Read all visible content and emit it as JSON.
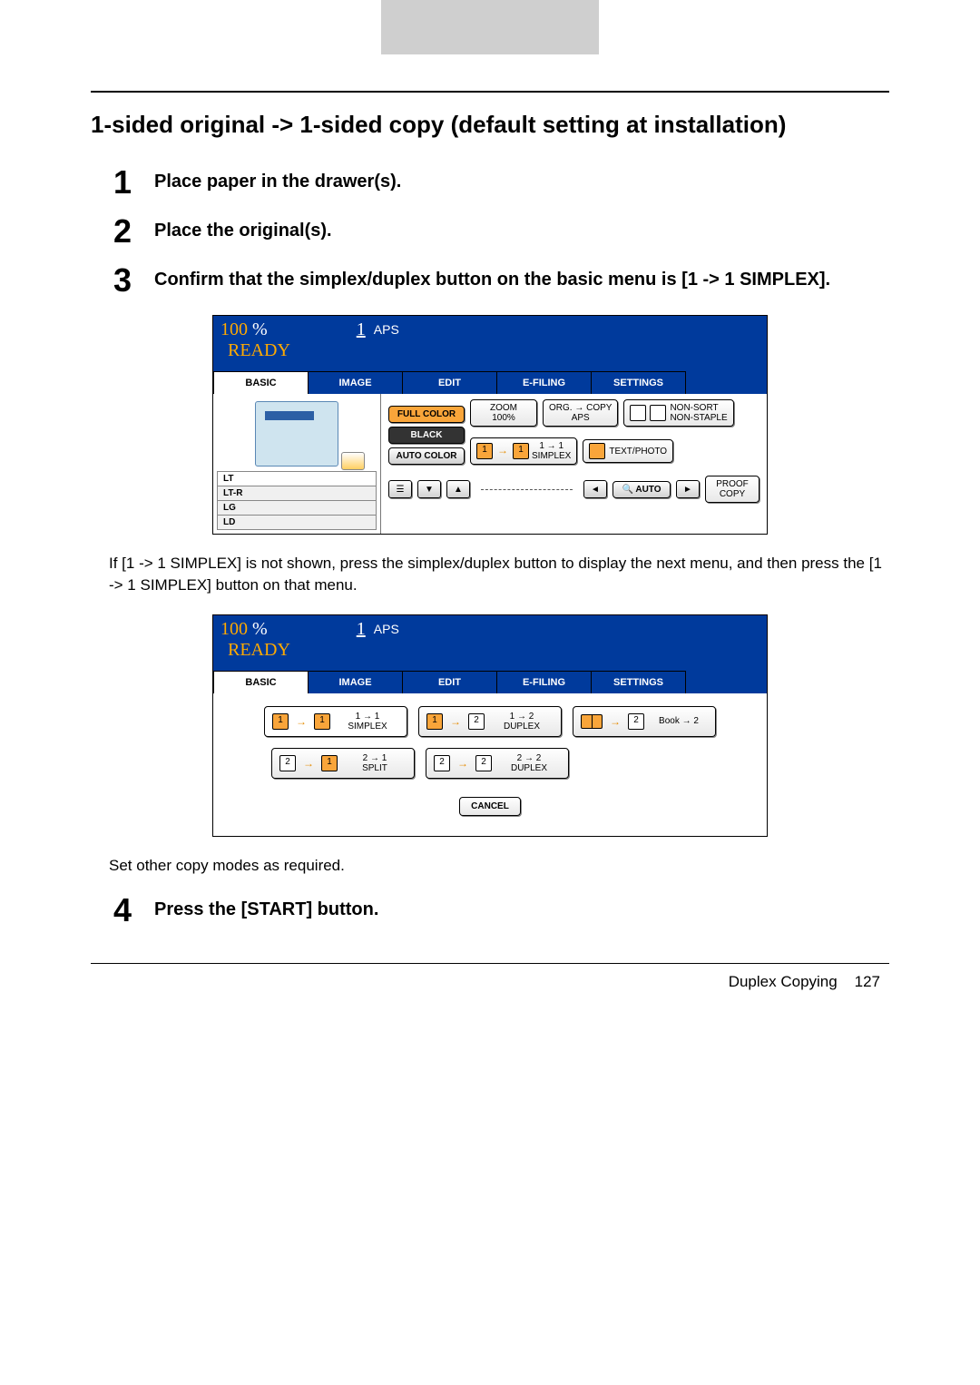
{
  "section_title": "1-sided original -> 1-sided copy (default setting at installation)",
  "steps": {
    "s1": {
      "num": "1",
      "text": "Place paper in the drawer(s)."
    },
    "s2": {
      "num": "2",
      "text": "Place the original(s)."
    },
    "s3": {
      "num": "3",
      "text": "Confirm that the simplex/duplex button on the basic menu is [1 -> 1 SIMPLEX]."
    },
    "s4": {
      "num": "4",
      "text": "Press the [START] button."
    }
  },
  "note1": "If [1 -> 1 SIMPLEX] is not shown, press the simplex/duplex button to display the next menu, and then press the [1 -> 1 SIMPLEX] button on that menu.",
  "note2": "Set other copy modes as required.",
  "footer": {
    "section": "Duplex Copying",
    "page": "127"
  },
  "scr": {
    "zoom": "100",
    "pct": "%",
    "count": "1",
    "aps": "APS",
    "ready": "READY",
    "tabs": {
      "basic": "BASIC",
      "image": "IMAGE",
      "edit": "EDIT",
      "efiling": "E-FILING",
      "settings": "SETTINGS"
    },
    "trays": {
      "lt": "LT",
      "ltr": "LT-R",
      "lg": "LG",
      "ld": "LD"
    },
    "color": {
      "full": "FULL COLOR",
      "black": "BLACK",
      "auto": "AUTO COLOR"
    },
    "zoomcell": {
      "top": "ZOOM",
      "bot": "100%"
    },
    "orgcell": {
      "top": "ORG. → COPY",
      "bot": "APS"
    },
    "sort": {
      "top": "NON-SORT",
      "bot": "NON-STAPLE"
    },
    "simplex": {
      "top": "1 → 1",
      "bot": "SIMPLEX"
    },
    "tp": "TEXT/PHOTO",
    "autobtn": "AUTO",
    "proof": {
      "top": "PROOF",
      "bot": "COPY"
    }
  },
  "menu": {
    "o11": {
      "top": "1 → 1",
      "bot": "SIMPLEX"
    },
    "o12": {
      "top": "1 → 2",
      "bot": "DUPLEX"
    },
    "ob2": "Book → 2",
    "o21": {
      "top": "2 → 1",
      "bot": "SPLIT"
    },
    "o22": {
      "top": "2 → 2",
      "bot": "DUPLEX"
    },
    "cancel": "CANCEL"
  }
}
